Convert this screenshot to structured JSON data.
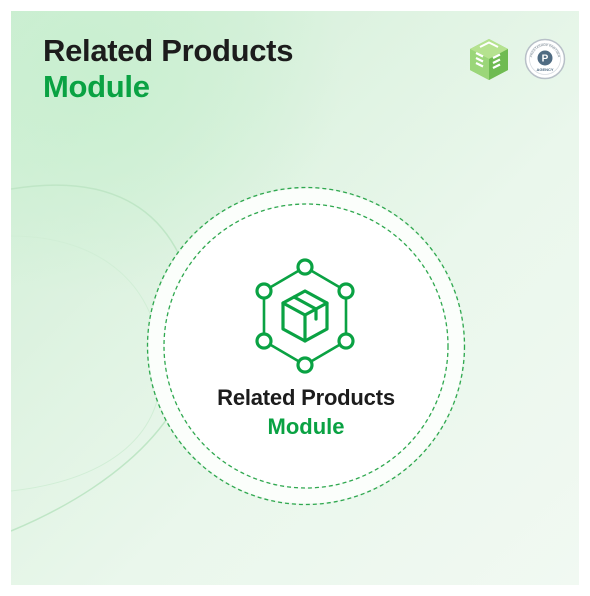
{
  "header": {
    "title_line1": "Related Products",
    "title_line2": "Module"
  },
  "badges": {
    "agency_badge": {
      "text_top": "PRESTASHOP PARTNER",
      "letter": "P",
      "text_bottom": "AGENCY"
    }
  },
  "center": {
    "label_line1": "Related Products",
    "label_line2": "Module"
  },
  "colors": {
    "accent_green": "#0aa243",
    "title_dark": "#1c1c1c",
    "background_mint": "#dff3e2"
  },
  "icons": [
    "module-network-icon",
    "product-box-icon",
    "vendor-logo-icon",
    "prestashop-partner-badge-icon"
  ]
}
